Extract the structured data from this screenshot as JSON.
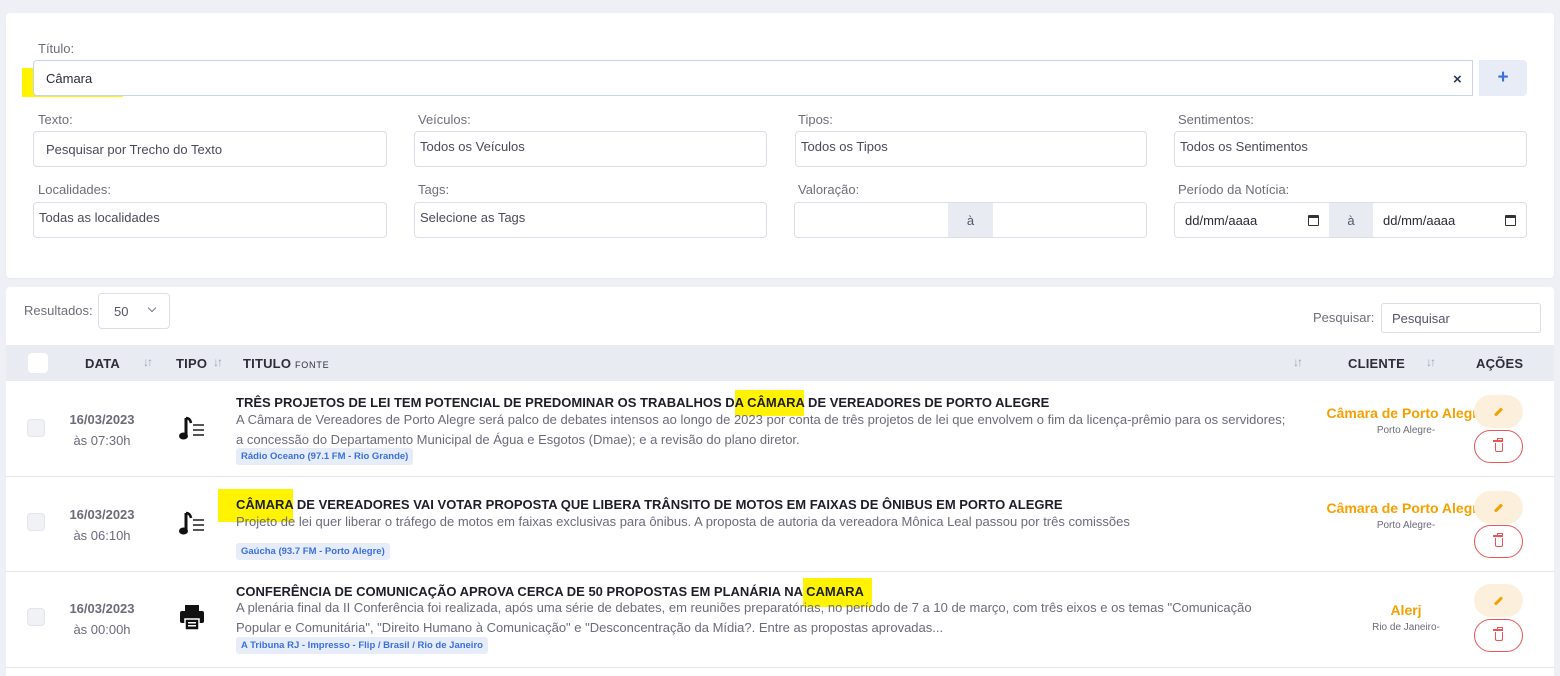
{
  "filters": {
    "title_label": "Título:",
    "title_value": "Câmara",
    "clear_symbol": "×",
    "add_symbol": "+",
    "text_label": "Texto:",
    "text_placeholder": "Pesquisar por Trecho do Texto",
    "vehicles_label": "Veículos:",
    "vehicles_value": "Todos os Veículos",
    "types_label": "Tipos:",
    "types_value": "Todos os Tipos",
    "sentiments_label": "Sentimentos:",
    "sentiments_value": "Todos os Sentimentos",
    "locations_label": "Localidades:",
    "locations_value": "Todas as localidades",
    "tags_label": "Tags:",
    "tags_value": "Selecione as Tags",
    "valuation_label": "Valoração:",
    "valuation_to": "à",
    "period_label": "Período da Notícia:",
    "period_from": "dd/mm/aaaa",
    "period_to_sep": "à",
    "period_to": "dd/mm/aaaa"
  },
  "results": {
    "results_label": "Resultados:",
    "page_size": "50",
    "search_label": "Pesquisar:",
    "search_placeholder": "Pesquisar"
  },
  "table": {
    "headers": {
      "date": "DATA",
      "type": "TIPO",
      "title": "TITULO",
      "source": "FONTE",
      "client": "CLIENTE",
      "actions": "AÇÕES"
    },
    "rows": [
      {
        "date": "16/03/2023",
        "time": "às 07:30h",
        "type_icon": "radio-icon",
        "title_pre": "TRÊS PROJETOS DE LEI TEM POTENCIAL DE PREDOMINAR OS TRABALHOS D",
        "title_hl": "A CÂMARA",
        "title_post": " DE VEREADORES DE PORTO ALEGRE",
        "text": "A Câmara de Vereadores de Porto Alegre será palco de debates intensos ao longo de 2023 por conta de três projetos de lei que envolvem o fim da licença-prêmio para os servidores; a concessão do Departamento Municipal de Água e Esgotos (Dmae); e a revisão do plano diretor.",
        "source": "Rádio Oceano (97.1 FM - Rio Grande)",
        "client": "Câmara de Porto Alegre",
        "client_location": "Porto Alegre-"
      },
      {
        "date": "16/03/2023",
        "time": "às 06:10h",
        "type_icon": "radio-icon",
        "title_pre": "",
        "title_hl": "CÂMARA",
        "title_post": " DE VEREADORES VAI VOTAR PROPOSTA QUE LIBERA TRÂNSITO DE MOTOS EM FAIXAS DE ÔNIBUS EM PORTO ALEGRE",
        "text": "Projeto de lei quer liberar o tráfego de motos em faixas exclusivas para ônibus. A proposta de autoria da vereadora Mônica Leal passou por três comissões",
        "source": "Gaúcha (93.7 FM - Porto Alegre)",
        "client": "Câmara de Porto Alegre",
        "client_location": "Porto Alegre-"
      },
      {
        "date": "16/03/2023",
        "time": "às 00:00h",
        "type_icon": "print-icon",
        "title_pre": "CONFERÊNCIA DE COMUNICAÇÃO APROVA CERCA DE 50 PROPOSTAS EM PLANÁRIA NA",
        "title_hl": " CAMARA",
        "title_post": "",
        "text": "A plenária final da II Conferência foi realizada, após uma série de debates, em reuniões preparatórias, no período de 7 a 10 de março, com três eixos e os temas \"Comunicação Popular e Comunitária\", \"Direito Humano à Comunicação\" e \"Desconcentração da Mídia?. Entre as propostas aprovadas...",
        "source": "A Tribuna RJ - Impresso - Flip / Brasil / Rio de Janeiro",
        "client": "Alerj",
        "client_location": "Rio de Janeiro-"
      }
    ]
  },
  "colors": {
    "highlight": "#fff300",
    "client_accent": "#f5a000",
    "delete_accent": "#ea5455",
    "badge_text": "#3b6fe0"
  }
}
